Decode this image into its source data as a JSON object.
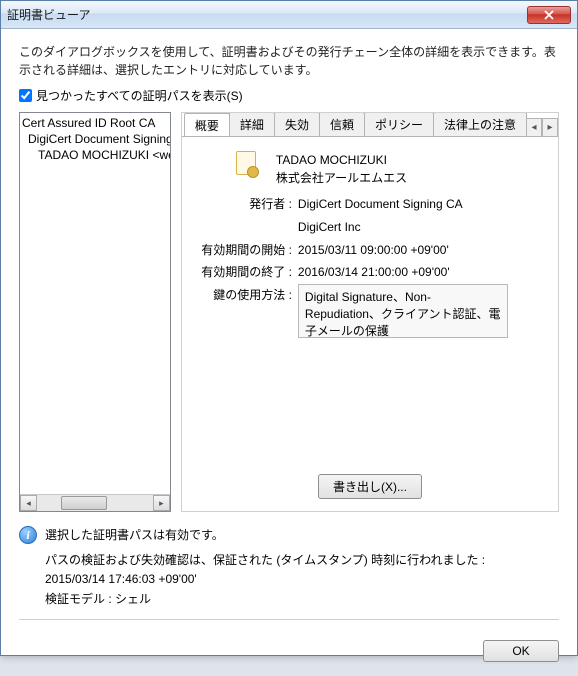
{
  "window": {
    "title": "証明書ビューア"
  },
  "description": "このダイアログボックスを使用して、証明書およびその発行チェーン全体の詳細を表示できます。表示される詳細は、選択したエントリに対応しています。",
  "show_all_paths": {
    "label": "見つかったすべての証明パスを表示(S)",
    "checked": true
  },
  "tree": {
    "items": [
      "Cert Assured ID Root CA",
      "DigiCert Document Signing CA",
      "TADAO MOCHIZUKI <webm"
    ]
  },
  "tabs": {
    "labels": [
      "概要",
      "詳細",
      "失効",
      "信頼",
      "ポリシー",
      "法律上の注意"
    ],
    "active_index": 0
  },
  "cert": {
    "subject": "TADAO MOCHIZUKI",
    "org": "株式会社アールエムエス",
    "issuer_label": "発行者 :",
    "issuer": "DigiCert Document Signing CA",
    "issuer_root": "DigiCert Inc",
    "valid_from_label": "有効期間の開始 :",
    "valid_from": "2015/03/11 09:00:00 +09'00'",
    "valid_to_label": "有効期間の終了 :",
    "valid_to": "2016/03/14 21:00:00 +09'00'",
    "key_usage_label": "鍵の使用方法 :",
    "key_usage": "Digital Signature、Non-Repudiation、クライアント認証、電子メールの保護"
  },
  "export_button": "書き出し(X)...",
  "status": {
    "line1": "選択した証明書パスは有効です。",
    "line2": "パスの検証および失効確認は、保証された (タイムスタンプ) 時刻に行われました :",
    "timestamp": "2015/03/14 17:46:03 +09'00'",
    "model_label": "検証モデル : シェル"
  },
  "ok_button": "OK"
}
